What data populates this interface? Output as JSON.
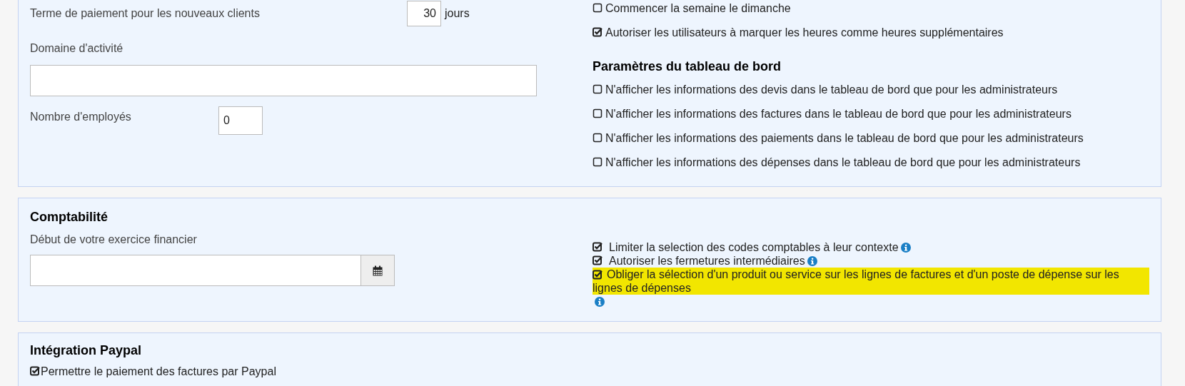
{
  "sections": [
    {
      "kind": "general",
      "fields": [
        {
          "kind": "term",
          "label": "Terme de paiement pour les nouveaux clients",
          "value": "30",
          "suffix": "jours"
        },
        {
          "kind": "wide",
          "label": "Domaine d'activité"
        },
        {
          "kind": "count",
          "label": "Nombre d'employés",
          "value": "0"
        }
      ],
      "options": [
        {
          "kind": "option",
          "label": "Commencer la semaine le dimanche",
          "checked": false,
          "info": false,
          "highlighted": false
        },
        {
          "kind": "option",
          "label": "Autoriser les utilisateurs à marquer les heures comme heures supplémentaires",
          "checked": true,
          "info": false,
          "highlighted": false
        },
        {
          "kind": "heading",
          "label": "Paramètres du tableau de bord"
        },
        {
          "kind": "option",
          "label": "N'afficher les informations des devis dans le tableau de bord que pour les administrateurs",
          "checked": false,
          "info": false,
          "highlighted": false
        },
        {
          "kind": "option",
          "label": "N'afficher les informations des factures dans le tableau de bord que pour les administrateurs",
          "checked": false,
          "info": false,
          "highlighted": false
        },
        {
          "kind": "option",
          "label": "N'afficher les informations des paiements dans le tableau de bord que pour les administrateurs",
          "checked": false,
          "info": false,
          "highlighted": false
        },
        {
          "kind": "option",
          "label": "N'afficher les informations des dépenses dans le tableau de bord que pour les administrateurs",
          "checked": false,
          "info": false,
          "highlighted": false
        }
      ]
    },
    {
      "kind": "accounting",
      "title": "Comptabilité",
      "fields": [
        {
          "kind": "date",
          "label": "Début de votre exercice financier"
        }
      ],
      "options": [
        {
          "kind": "option",
          "label": "Limiter la selection des codes comptables à leur contexte",
          "checked": true,
          "info": true,
          "highlighted": false
        },
        {
          "kind": "option",
          "label": "Autoriser les fermetures intermédiaires",
          "checked": true,
          "info": true,
          "highlighted": false
        },
        {
          "kind": "option",
          "label": "Obliger la sélection d'un produit ou service sur les lignes de factures et d'un poste de dépense sur les lignes de dépenses",
          "checked": true,
          "info": true,
          "highlighted": true
        }
      ]
    },
    {
      "kind": "paypal",
      "title": "Intégration Paypal",
      "options": [
        {
          "kind": "option",
          "label": "Permettre le paiement des factures par Paypal",
          "checked": true,
          "info": false,
          "highlighted": false
        }
      ]
    }
  ]
}
